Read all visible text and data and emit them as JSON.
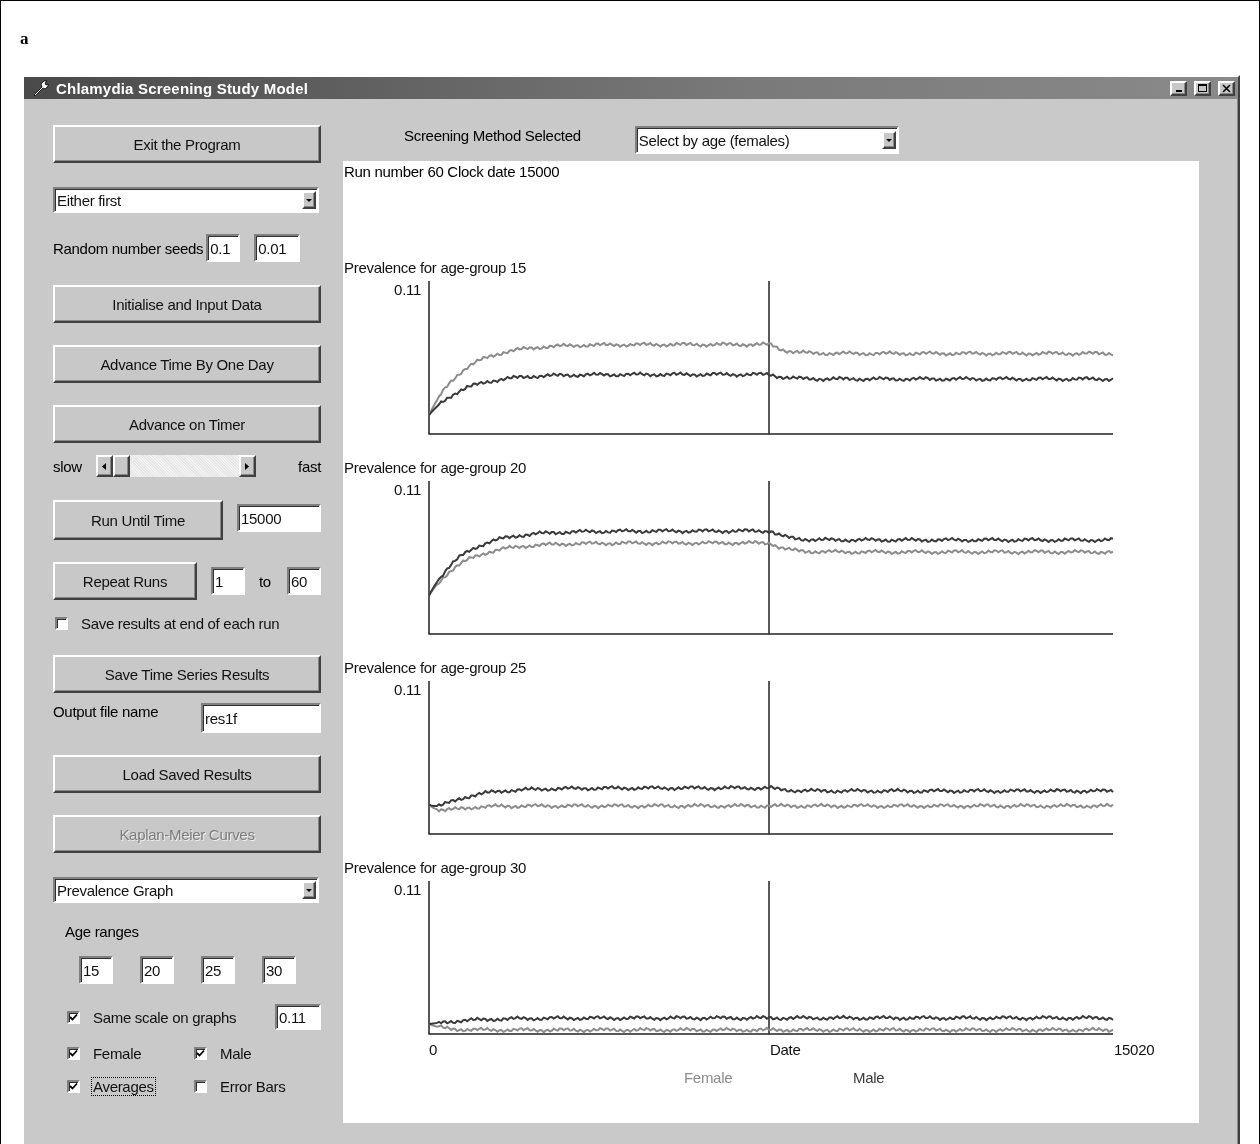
{
  "figure_label": "a",
  "window": {
    "title": "Chlamydia Screening Study Model"
  },
  "left_panel": [
    {
      "kind": "button",
      "label": "Exit the Program",
      "disabled": false
    },
    {
      "kind": "combo",
      "value": "Either first"
    },
    {
      "kind": "seeds",
      "label": "Random number seeds",
      "values": [
        "0.1",
        "0.01"
      ]
    },
    {
      "kind": "button",
      "label": "Initialise and Input Data",
      "disabled": false
    },
    {
      "kind": "button",
      "label": "Advance Time By One Day",
      "disabled": false
    },
    {
      "kind": "button",
      "label": "Advance on Timer",
      "disabled": false
    },
    {
      "kind": "slider",
      "min_label": "slow",
      "max_label": "fast",
      "level": 0
    },
    {
      "kind": "button_field",
      "label": "Run Until Time",
      "value": "15000"
    },
    {
      "kind": "range",
      "label": "Repeat Runs",
      "from": "1",
      "to_label": "to",
      "to": "60"
    },
    {
      "kind": "check",
      "label": "Save results at end of each run",
      "checked": false
    },
    {
      "kind": "button",
      "label": "Save Time Series Results",
      "disabled": false
    },
    {
      "kind": "labeled_field",
      "label": "Output file name",
      "value": "res1f"
    },
    {
      "kind": "button",
      "label": "Load Saved Results",
      "disabled": false
    },
    {
      "kind": "button",
      "label": "Kaplan-Meier Curves",
      "disabled": true
    },
    {
      "kind": "combo",
      "value": "Prevalence Graph"
    },
    {
      "kind": "heading",
      "label": "Age ranges"
    },
    {
      "kind": "fields",
      "values": [
        "15",
        "20",
        "25",
        "30"
      ]
    },
    {
      "kind": "check_field",
      "label": "Same scale on graphs",
      "checked": true,
      "value": "0.11"
    },
    {
      "kind": "check_pair",
      "items": [
        {
          "label": "Female",
          "checked": true,
          "focused": false
        },
        {
          "label": "Male",
          "checked": true,
          "focused": false
        }
      ]
    },
    {
      "kind": "check_pair",
      "items": [
        {
          "label": "Averages",
          "checked": true,
          "focused": true
        },
        {
          "label": "Error Bars",
          "checked": false,
          "focused": false
        }
      ]
    }
  ],
  "screening": {
    "label": "Screening Method Selected",
    "value": "Select by age (females)"
  },
  "plot": {
    "status": "Run number 60 Clock date 15000",
    "graphs": [
      {
        "title": "Prevalence for age-group 15",
        "y_tick": "0.11"
      },
      {
        "title": "Prevalence for age-group 20",
        "y_tick": "0.11"
      },
      {
        "title": "Prevalence for age-group 25",
        "y_tick": "0.11"
      },
      {
        "title": "Prevalence for age-group 30",
        "y_tick": "0.11"
      }
    ],
    "x_axis": {
      "start": "0",
      "label": "Date",
      "end": "15020"
    },
    "legend": [
      {
        "label": "Female",
        "color": "#8c8c8c"
      },
      {
        "label": "Male",
        "color": "#3a3a3a"
      }
    ]
  }
}
